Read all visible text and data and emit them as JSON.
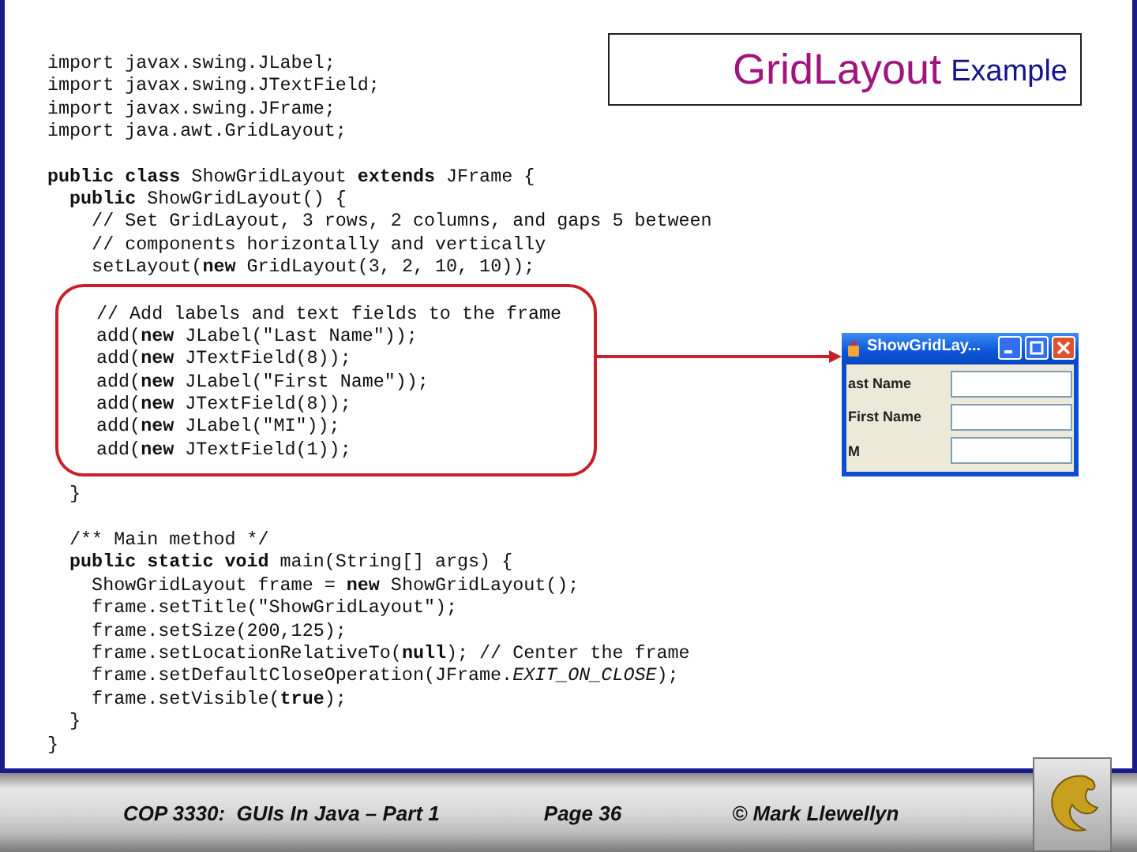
{
  "title": {
    "main": "GridLayout",
    "sub": "Example"
  },
  "code_blocks": [
    {
      "kind": "plain",
      "lines": [
        "import javax.swing.JLabel;",
        "import javax.swing.JTextField;",
        "import javax.swing.JFrame;",
        "import java.awt.GridLayout;"
      ]
    },
    {
      "kind": "plain",
      "lines": [
        "**public class** ShowGridLayout **extends** JFrame {",
        "  **public** ShowGridLayout() {",
        "    // Set GridLayout, 3 rows, 2 columns, and gaps 5 between",
        "    // components horizontally and vertically",
        "    setLayout(**new** GridLayout(3, 2, 10, 10));"
      ]
    },
    {
      "kind": "highlighted",
      "lines": [
        "// Add labels and text fields to the frame",
        "add(**new** JLabel(\"Last Name\"));",
        "add(**new** JTextField(8));",
        "add(**new** JLabel(\"First Name\"));",
        "add(**new** JTextField(8));",
        "add(**new** JLabel(\"MI\"));",
        "add(**new** JTextField(1));"
      ]
    },
    {
      "kind": "plain",
      "lines": [
        "  }"
      ]
    },
    {
      "kind": "plain",
      "lines": [
        "  /** Main method */",
        "  **public static void** main(String[] args) {",
        "    ShowGridLayout frame = **new** ShowGridLayout();",
        "    frame.setTitle(\"ShowGridLayout\");",
        "    frame.setSize(200,125);",
        "    frame.setLocationRelativeTo(**null**); // Center the frame",
        "    frame.setDefaultCloseOperation(JFrame.*EXIT_ON_CLOSE*);",
        "    frame.setVisible(**true**);",
        "  }",
        "}"
      ]
    }
  ],
  "java_window": {
    "title": "ShowGridLay...",
    "rows": [
      {
        "label": "ast Name"
      },
      {
        "label": "First Name"
      },
      {
        "label": "M"
      }
    ]
  },
  "footer": {
    "course": "COP 3330:  GUIs In Java – Part 1",
    "page": "Page 36",
    "copyright": "© Mark Llewellyn"
  }
}
